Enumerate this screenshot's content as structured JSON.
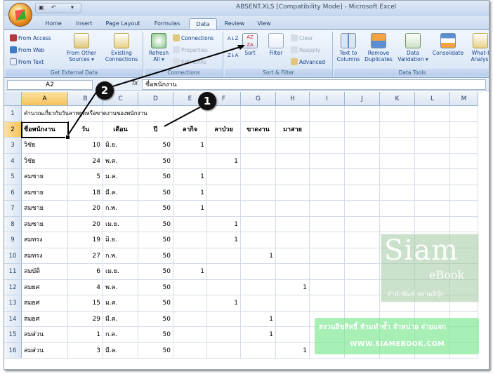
{
  "window": {
    "title": "ABSENT.XLS [Compatibility Mode] - Microsoft Excel"
  },
  "qat": {
    "save": "▣",
    "undo": "↶",
    "more": "▾"
  },
  "tabs": [
    "Home",
    "Insert",
    "Page Layout",
    "Formulas",
    "Data",
    "Review",
    "View"
  ],
  "active_tab": "Data",
  "ribbon": {
    "external": {
      "label": "Get External Data",
      "from_access": "From Access",
      "from_web": "From Web",
      "from_text": "From Text",
      "from_other": "From Other",
      "from_other2": "Sources ▾",
      "existing": "Existing",
      "existing2": "Connections"
    },
    "connections": {
      "label": "Connections",
      "refresh": "Refresh",
      "refresh2": "All ▾",
      "connections": "Connections",
      "properties": "Properties",
      "edit_links": "Edit Links"
    },
    "sortfilter": {
      "label": "Sort & Filter",
      "sort": "Sort",
      "filter": "Filter",
      "clear": "Clear",
      "reapply": "Reapply",
      "advanced": "Advanced"
    },
    "datatools": {
      "label": "Data Tools",
      "text_to_columns": "Text to",
      "text_to_columns2": "Columns",
      "remove_dup": "Remove",
      "remove_dup2": "Duplicates",
      "validation": "Data",
      "validation2": "Validation ▾",
      "consolidate": "Consolidate",
      "whatif": "What-I",
      "whatif2": "Analysi"
    }
  },
  "formula_bar": {
    "name_box": "A2",
    "fx": "fx",
    "value": "ชื่อพนักงาน"
  },
  "columns": [
    "A",
    "B",
    "C",
    "D",
    "E",
    "F",
    "G",
    "H",
    "I",
    "J",
    "K",
    "L",
    "M"
  ],
  "rows": [
    {
      "num": "1",
      "cells": [
        "คำนวณเกี่ยวกับวันลาหยุดหรือขาดงานของพนักงาน",
        "",
        "",
        "",
        "",
        "",
        "",
        "",
        ""
      ]
    },
    {
      "num": "2",
      "cells": [
        "ชื่อพนักงาน",
        "วัน",
        "เดือน",
        "ปี",
        "ลากิจ",
        "ลาป่วย",
        "ขาดงาน",
        "มาสาย",
        ""
      ]
    },
    {
      "num": "3",
      "cells": [
        "วิชัย",
        "10",
        "มิ.ย.",
        "50",
        "1",
        "",
        "",
        "",
        ""
      ]
    },
    {
      "num": "4",
      "cells": [
        "วิชัย",
        "24",
        "พ.ค.",
        "50",
        "",
        "1",
        "",
        "",
        ""
      ]
    },
    {
      "num": "5",
      "cells": [
        "สมชาย",
        "5",
        "ม.ค.",
        "50",
        "1",
        "",
        "",
        "",
        ""
      ]
    },
    {
      "num": "6",
      "cells": [
        "สมชาย",
        "18",
        "มี.ค.",
        "50",
        "1",
        "",
        "",
        "",
        ""
      ]
    },
    {
      "num": "7",
      "cells": [
        "สมชาย",
        "20",
        "ก.พ.",
        "50",
        "1",
        "",
        "",
        "",
        ""
      ]
    },
    {
      "num": "8",
      "cells": [
        "สมชาย",
        "20",
        "เม.ย.",
        "50",
        "",
        "1",
        "",
        "",
        ""
      ]
    },
    {
      "num": "9",
      "cells": [
        "สมทรง",
        "19",
        "มิ.ย.",
        "50",
        "",
        "1",
        "",
        "",
        ""
      ]
    },
    {
      "num": "10",
      "cells": [
        "สมทรง",
        "27",
        "ก.พ.",
        "50",
        "",
        "",
        "1",
        "",
        ""
      ]
    },
    {
      "num": "11",
      "cells": [
        "สมบัติ",
        "6",
        "เม.ย.",
        "50",
        "1",
        "",
        "",
        "",
        ""
      ]
    },
    {
      "num": "12",
      "cells": [
        "สมยศ",
        "4",
        "พ.ค.",
        "50",
        "",
        "",
        "",
        "1",
        ""
      ]
    },
    {
      "num": "13",
      "cells": [
        "สมยศ",
        "15",
        "ม.ค.",
        "50",
        "",
        "1",
        "",
        "",
        ""
      ]
    },
    {
      "num": "14",
      "cells": [
        "สมยศ",
        "29",
        "มี.ค.",
        "50",
        "",
        "",
        "1",
        "",
        ""
      ]
    },
    {
      "num": "15",
      "cells": [
        "สมส่วน",
        "1",
        "ก.ค.",
        "50",
        "",
        "",
        "1",
        "",
        ""
      ]
    },
    {
      "num": "16",
      "cells": [
        "สมส่วน",
        "3",
        "มี.ค.",
        "50",
        "",
        "",
        "",
        "1",
        ""
      ]
    }
  ],
  "callouts": {
    "one": "1",
    "two": "2"
  },
  "watermark": {
    "line1": "Siam",
    "line2": "eBook",
    "line3": "สำนักพิมพ์ สยามอีบุ๊ก"
  },
  "banner": {
    "line1": "สงวนลิขสิทธิ์ ห้ามทำซ้ำ จำหน่าย จ่ายแจก",
    "line2": "WWW.SIAMEBOOK.COM"
  }
}
